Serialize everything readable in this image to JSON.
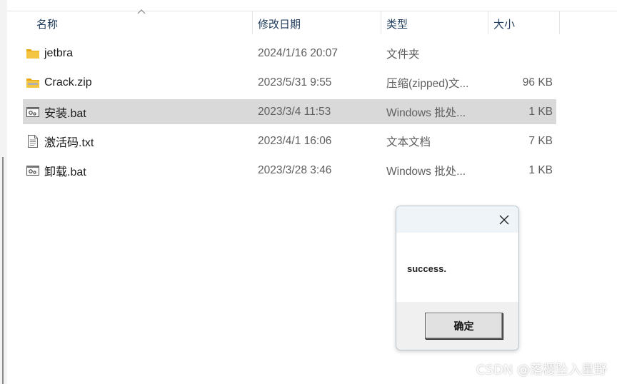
{
  "columns": {
    "name": "名称",
    "date": "修改日期",
    "type": "类型",
    "size": "大小"
  },
  "files": [
    {
      "name": "jetbra",
      "date": "2024/1/16 20:07",
      "type": "文件夹",
      "size": "",
      "icon": "folder-icon"
    },
    {
      "name": "Crack.zip",
      "date": "2023/5/31 9:55",
      "type": "压缩(zipped)文...",
      "size": "96 KB",
      "icon": "zip-folder-icon"
    },
    {
      "name": "安装.bat",
      "date": "2023/3/4 11:53",
      "type": "Windows 批处...",
      "size": "1 KB",
      "icon": "batch-file-icon",
      "selected": true
    },
    {
      "name": "激活码.txt",
      "date": "2023/4/1 16:06",
      "type": "文本文档",
      "size": "7 KB",
      "icon": "text-file-icon"
    },
    {
      "name": "卸载.bat",
      "date": "2023/3/28 3:46",
      "type": "Windows 批处...",
      "size": "1 KB",
      "icon": "batch-file-icon"
    }
  ],
  "dialog": {
    "message": "success.",
    "ok_label": "确定"
  },
  "watermark": "CSDN @落樱坠入星野",
  "colors": {
    "selected_row": "#d9d9d9",
    "folder_yellow": "#f4c542",
    "header_text": "#1f3b5c"
  }
}
